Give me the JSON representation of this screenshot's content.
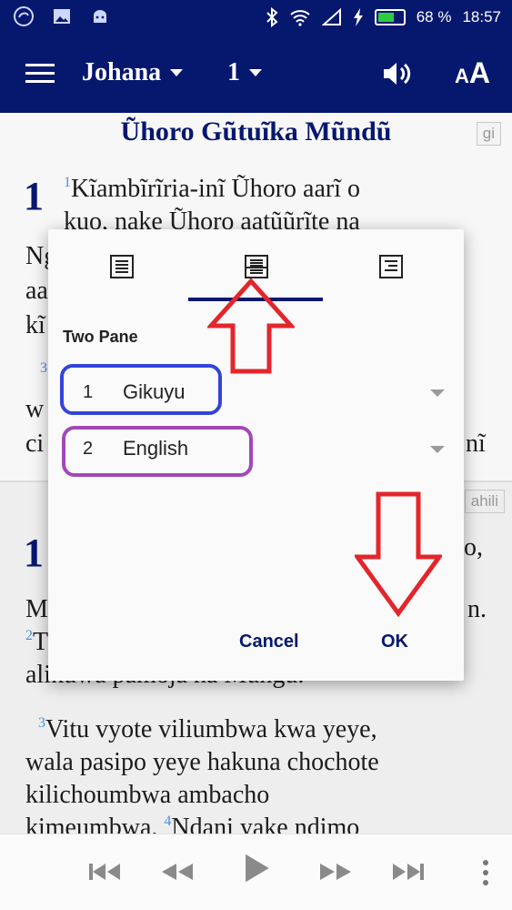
{
  "status_bar": {
    "battery_percent": "68 %",
    "time": "18:57",
    "battery_level": 0.68,
    "icons": [
      "app-icon",
      "image-icon",
      "android-icon",
      "bluetooth-icon",
      "wifi-icon",
      "signal-icon",
      "charging-icon",
      "battery-icon"
    ]
  },
  "app_bar": {
    "book": "Johana",
    "chapter": "1",
    "icons": [
      "menu-icon",
      "speaker-icon",
      "text-size-icon"
    ],
    "text_size_label": "A"
  },
  "pane_top": {
    "title": "Ũhoro Gũtuĩka Mũndũ",
    "lang_tag": "gi",
    "chapter_number": "1",
    "verse1_num": "1",
    "line1": "Kĩambĩrĩria-inĩ Ũhoro aarĩ o",
    "line2": "kuo, nake Ũhoro aatũũrĩte na",
    "line3_start": "Ng",
    "line4_start": "aa",
    "line5_start": "kĩ",
    "verse3_num": "3",
    "line6_start": "w",
    "line7_start": "ci",
    "line7_end": "nĩ"
  },
  "pane_bottom": {
    "lang_tag_partial": "ahili",
    "chapter_number": "1",
    "line1_end": "o,",
    "line2_start": "M",
    "line2_end": "n.",
    "verse2_num": "2",
    "line3_start": "T",
    "line4": "alikuwa pamoja na Mungu.",
    "verse3_num": "3",
    "line5": "Vitu vyote viliumbwa kwa yeye,",
    "line6": "wala pasipo yeye hakuna chochote",
    "line7": "kilichoumbwa ambacho",
    "line8": "kimeumbwa.",
    "verse4_num": "4",
    "line8_cont": "Ndani yake ndimo"
  },
  "dialog": {
    "tabs": [
      "single-pane-icon",
      "two-pane-icon",
      "verse-by-verse-icon"
    ],
    "selected_tab": 1,
    "section_label": "Two Pane",
    "pane1": {
      "number": "1",
      "language": "Gikuyu"
    },
    "pane2": {
      "number": "2",
      "language": "English"
    },
    "cancel_label": "Cancel",
    "ok_label": "OK"
  },
  "annotations": {
    "blue_box_color": "#3344d8",
    "purple_box_color": "#a148b6",
    "arrow_color": "#e3262b"
  },
  "player": {
    "icons": [
      "skip-previous-icon",
      "rewind-icon",
      "play-icon",
      "fast-forward-icon",
      "skip-next-icon",
      "more-vert-icon"
    ]
  },
  "colors": {
    "primary": "#06186e",
    "verse_number": "#4a90e2"
  }
}
